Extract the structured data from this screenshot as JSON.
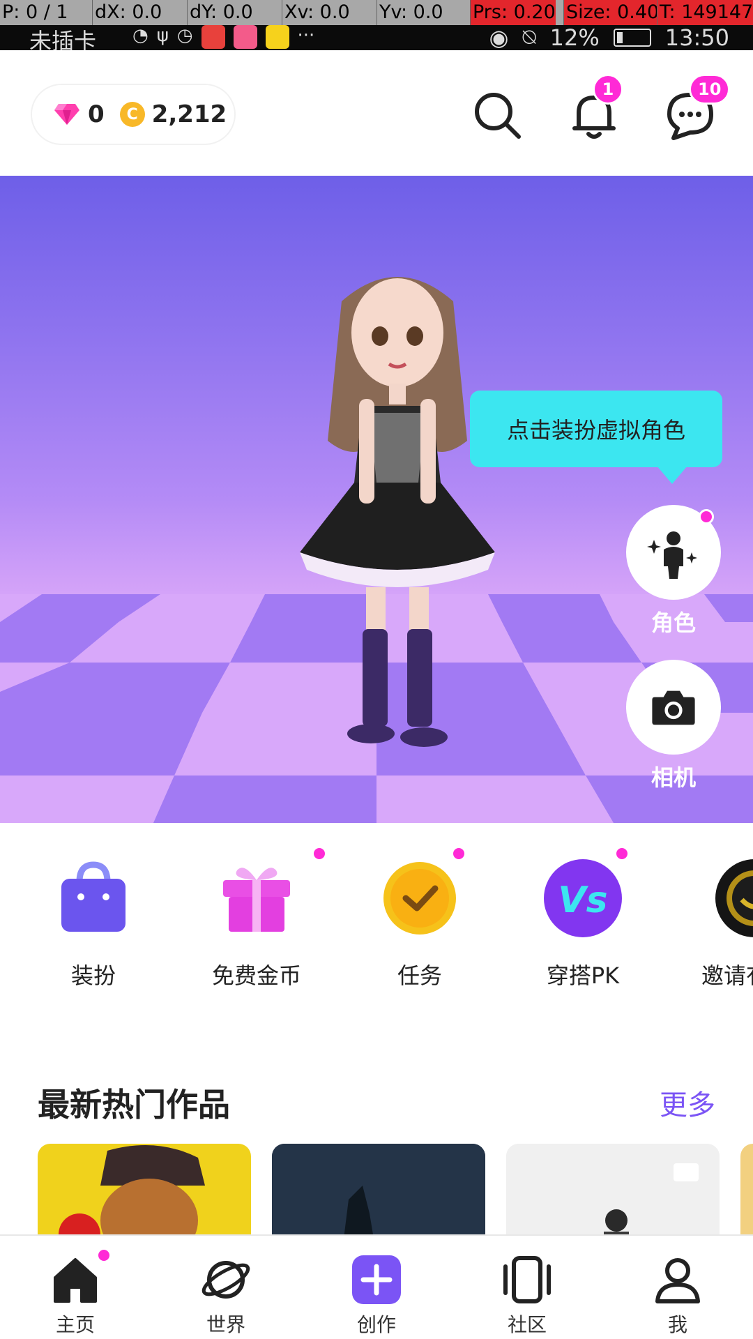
{
  "debug_bar": {
    "p": "P: 0 / 1",
    "dx": "dX: 0.0",
    "dy": "dY: 0.0",
    "xv": "Xv: 0.0",
    "yv": "Yv: 0.0",
    "prs": "Prs: 0.20",
    "size": "Size: 0.40",
    "t": "T: 149147"
  },
  "status_bar": {
    "carrier": "未插卡",
    "battery": "12%",
    "time": "13:50"
  },
  "header": {
    "gems": "0",
    "coins": "2,212",
    "coin_symbol": "C",
    "notification_count": "1",
    "message_count": "10"
  },
  "stage": {
    "tooltip": "点击装扮虚拟角色",
    "character_label": "角色",
    "camera_label": "相机"
  },
  "quick_actions": [
    {
      "label": "装扮",
      "icon": "shopping-bag-icon",
      "dot": false
    },
    {
      "label": "免费金币",
      "icon": "gift-icon",
      "dot": true
    },
    {
      "label": "任务",
      "icon": "checkmark-coin-icon",
      "dot": true
    },
    {
      "label": "穿搭PK",
      "icon": "vs-icon",
      "dot": true
    },
    {
      "label": "邀请有",
      "icon": "invite-icon",
      "dot": false
    }
  ],
  "section": {
    "title": "最新热门作品",
    "more": "更多"
  },
  "bottom_nav": [
    {
      "label": "主页",
      "icon": "home-icon"
    },
    {
      "label": "世界",
      "icon": "planet-icon"
    },
    {
      "label": "创作",
      "icon": "plus-icon"
    },
    {
      "label": "社区",
      "icon": "community-icon"
    },
    {
      "label": "我",
      "icon": "profile-icon"
    }
  ],
  "colors": {
    "accent": "#7b54f5",
    "badge": "#ff2ad6",
    "tooltip": "#3ce6f0",
    "stage_top": "#6e5fe8"
  }
}
